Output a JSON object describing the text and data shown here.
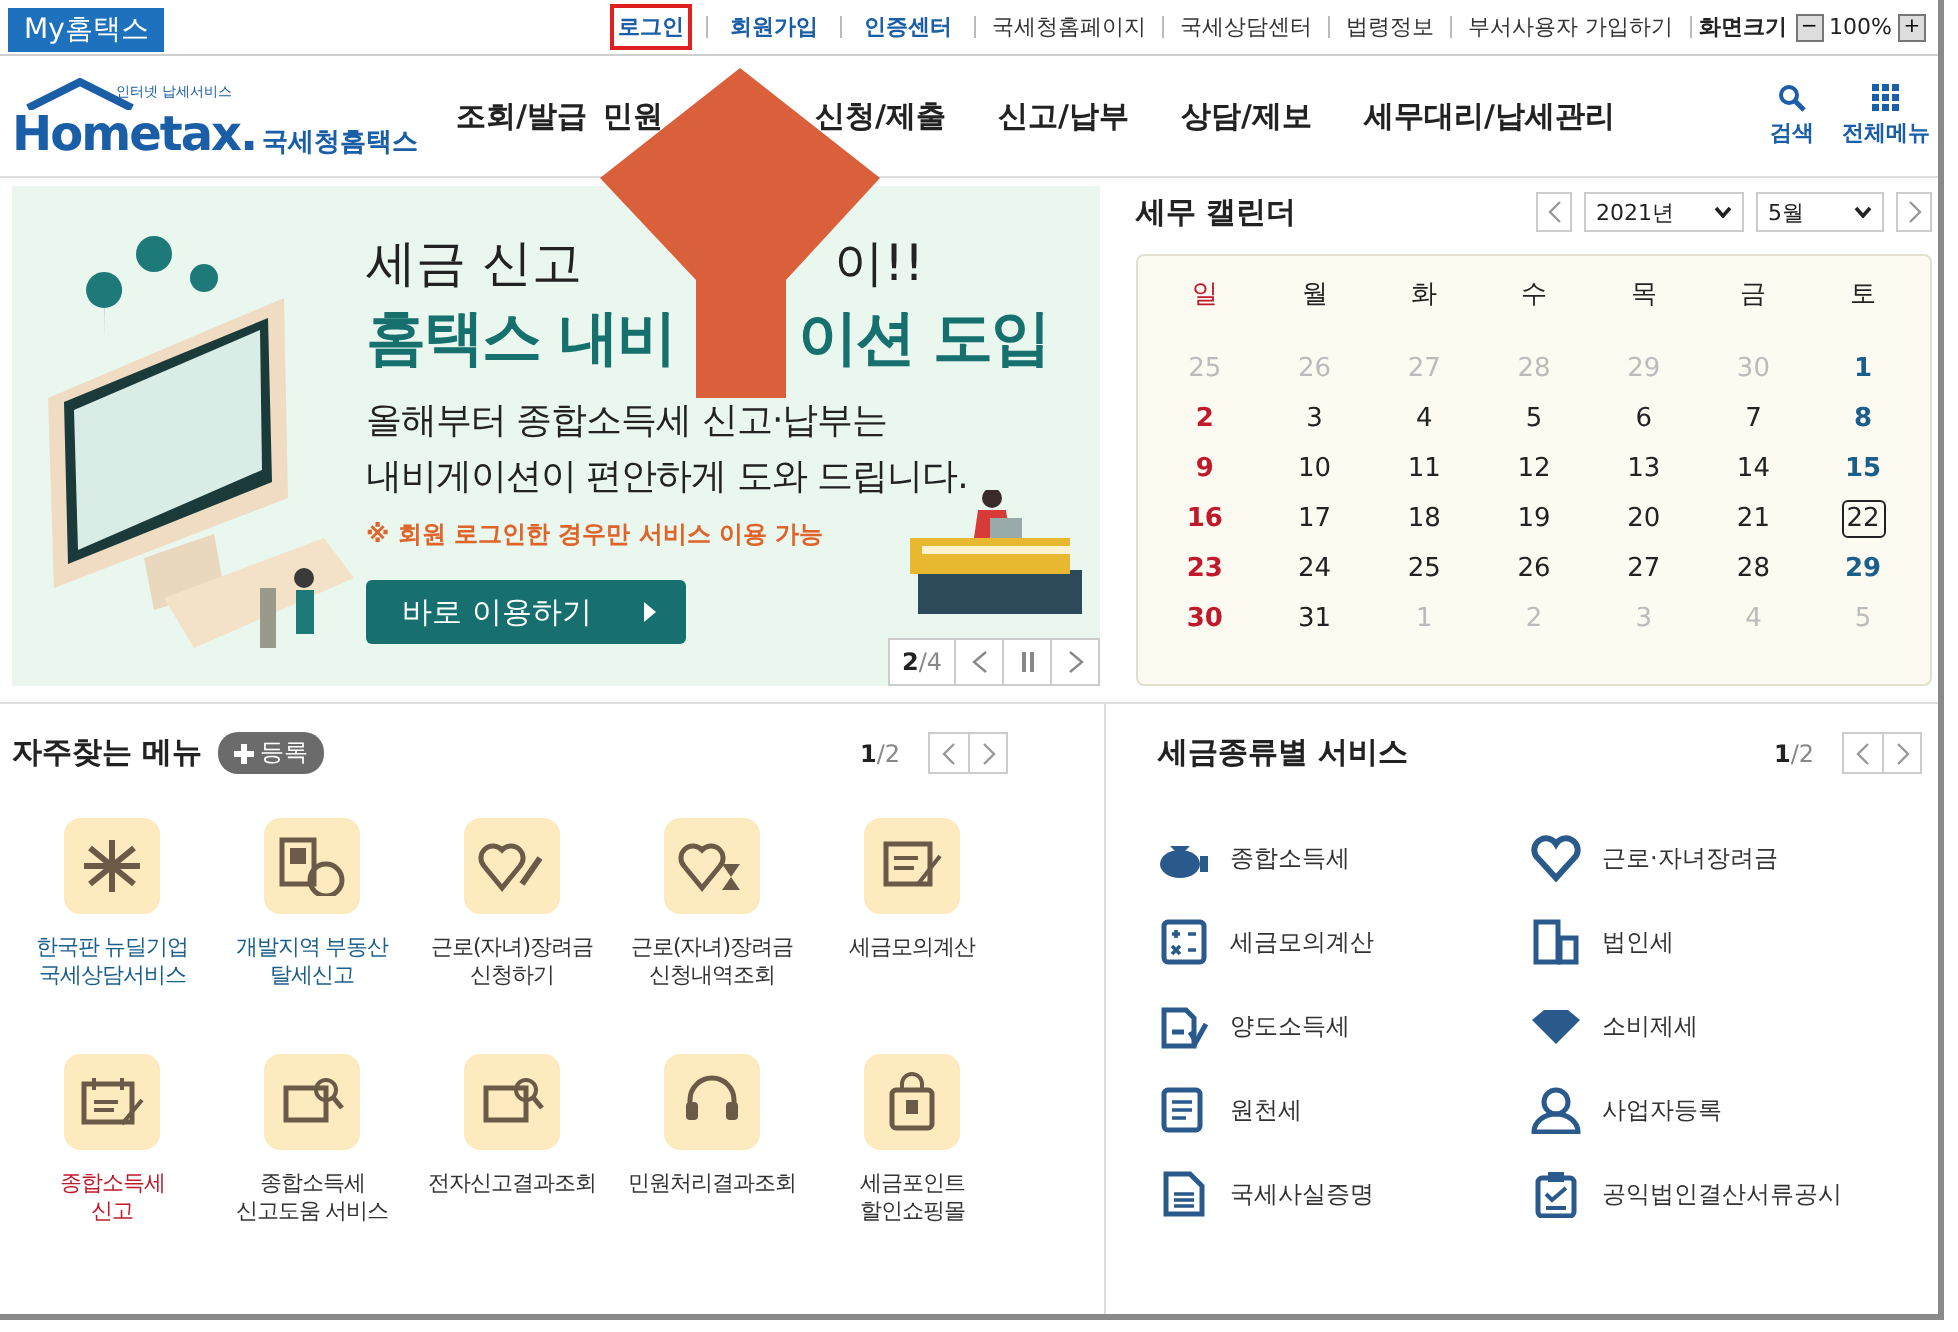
{
  "top_bar": {
    "brand_tab": "My홈택스",
    "links": [
      {
        "label": "로그인",
        "kind": "strong",
        "highlighted": true
      },
      {
        "label": "회원가입",
        "kind": "strong",
        "highlighted": false
      },
      {
        "label": "인증센터",
        "kind": "strong",
        "highlighted": false
      },
      {
        "label": "국세청홈페이지",
        "kind": "plain",
        "highlighted": false
      },
      {
        "label": "국세상담센터",
        "kind": "plain",
        "highlighted": false
      },
      {
        "label": "법령정보",
        "kind": "plain",
        "highlighted": false
      },
      {
        "label": "부서사용자 가입하기",
        "kind": "plain",
        "highlighted": false
      }
    ],
    "zoom": {
      "label": "화면크기",
      "minus": "−",
      "value": "100%",
      "plus": "+"
    }
  },
  "header": {
    "logo_tagline": "인터넷 납세서비스",
    "logo": "Hometax.",
    "logo_name": "국세청홈택스",
    "nav": [
      "조회/발급",
      "민원",
      "신청/제출",
      "신고/납부",
      "상담/제보",
      "세무대리/납세관리"
    ],
    "search": "검색",
    "all_menu": "전체메뉴"
  },
  "banner": {
    "headline_parts": [
      "세금 신고",
      "이!!"
    ],
    "title_parts": [
      "홈택스 내비",
      "이션 도입"
    ],
    "body_lines": [
      "올해부터 종합소득세 신고·납부는",
      "내비게이션이 편안하게 도와 드립니다."
    ],
    "notice": "※ 회원 로그인한 경우만 서비스 이용 가능",
    "button": "바로 이용하기",
    "page_current": "2",
    "page_total": "/4"
  },
  "calendar": {
    "title": "세무 캘린더",
    "year": "2021년",
    "month": "5월",
    "weekdays": [
      {
        "label": "일",
        "kind": "sun"
      },
      {
        "label": "월",
        "kind": "normal"
      },
      {
        "label": "화",
        "kind": "normal"
      },
      {
        "label": "수",
        "kind": "normal"
      },
      {
        "label": "목",
        "kind": "normal"
      },
      {
        "label": "금",
        "kind": "normal"
      },
      {
        "label": "토",
        "kind": "normal"
      }
    ],
    "weeks": [
      [
        {
          "day": "25",
          "kind": "other",
          "selected": false
        },
        {
          "day": "26",
          "kind": "other",
          "selected": false
        },
        {
          "day": "27",
          "kind": "other",
          "selected": false
        },
        {
          "day": "28",
          "kind": "other",
          "selected": false
        },
        {
          "day": "29",
          "kind": "other",
          "selected": false
        },
        {
          "day": "30",
          "kind": "other",
          "selected": false
        },
        {
          "day": "1",
          "kind": "sat",
          "selected": false
        }
      ],
      [
        {
          "day": "2",
          "kind": "sun",
          "selected": false
        },
        {
          "day": "3",
          "kind": "normal",
          "selected": false
        },
        {
          "day": "4",
          "kind": "normal",
          "selected": false
        },
        {
          "day": "5",
          "kind": "normal",
          "selected": false
        },
        {
          "day": "6",
          "kind": "normal",
          "selected": false
        },
        {
          "day": "7",
          "kind": "normal",
          "selected": false
        },
        {
          "day": "8",
          "kind": "sat",
          "selected": false
        }
      ],
      [
        {
          "day": "9",
          "kind": "sun",
          "selected": false
        },
        {
          "day": "10",
          "kind": "normal",
          "selected": false
        },
        {
          "day": "11",
          "kind": "normal",
          "selected": false
        },
        {
          "day": "12",
          "kind": "normal",
          "selected": false
        },
        {
          "day": "13",
          "kind": "normal",
          "selected": false
        },
        {
          "day": "14",
          "kind": "normal",
          "selected": false
        },
        {
          "day": "15",
          "kind": "sat",
          "selected": false
        }
      ],
      [
        {
          "day": "16",
          "kind": "sun",
          "selected": false
        },
        {
          "day": "17",
          "kind": "normal",
          "selected": false
        },
        {
          "day": "18",
          "kind": "normal",
          "selected": false
        },
        {
          "day": "19",
          "kind": "normal",
          "selected": false
        },
        {
          "day": "20",
          "kind": "normal",
          "selected": false
        },
        {
          "day": "21",
          "kind": "normal",
          "selected": false
        },
        {
          "day": "22",
          "kind": "normal",
          "selected": true
        }
      ],
      [
        {
          "day": "23",
          "kind": "sun",
          "selected": false
        },
        {
          "day": "24",
          "kind": "normal",
          "selected": false
        },
        {
          "day": "25",
          "kind": "normal",
          "selected": false
        },
        {
          "day": "26",
          "kind": "normal",
          "selected": false
        },
        {
          "day": "27",
          "kind": "normal",
          "selected": false
        },
        {
          "day": "28",
          "kind": "normal",
          "selected": false
        },
        {
          "day": "29",
          "kind": "sat",
          "selected": false
        }
      ],
      [
        {
          "day": "30",
          "kind": "sun",
          "selected": false
        },
        {
          "day": "31",
          "kind": "normal",
          "selected": false
        },
        {
          "day": "1",
          "kind": "other",
          "selected": false
        },
        {
          "day": "2",
          "kind": "other",
          "selected": false
        },
        {
          "day": "3",
          "kind": "other",
          "selected": false
        },
        {
          "day": "4",
          "kind": "other",
          "selected": false
        },
        {
          "day": "5",
          "kind": "other",
          "selected": false
        }
      ]
    ]
  },
  "frequent_menu": {
    "title": "자주찾는 메뉴",
    "add_button": "등록",
    "page_current": "1",
    "page_total": "/2",
    "items": [
      {
        "lines": [
          "한국판 뉴딜기업",
          "국세상담서비스"
        ],
        "kind": "link"
      },
      {
        "lines": [
          "개발지역 부동산",
          "탈세신고"
        ],
        "kind": "link"
      },
      {
        "lines": [
          "근로(자녀)장려금",
          "신청하기"
        ],
        "kind": "plain"
      },
      {
        "lines": [
          "근로(자녀)장려금",
          "신청내역조회"
        ],
        "kind": "plain"
      },
      {
        "lines": [
          "세금모의계산"
        ],
        "kind": "plain"
      },
      {
        "lines": [
          "종합소득세",
          "신고"
        ],
        "kind": "alert"
      },
      {
        "lines": [
          "종합소득세",
          "신고도움 서비스"
        ],
        "kind": "plain"
      },
      {
        "lines": [
          "전자신고결과조회"
        ],
        "kind": "plain"
      },
      {
        "lines": [
          "민원처리결과조회"
        ],
        "kind": "plain"
      },
      {
        "lines": [
          "세금포인트",
          "할인쇼핑몰"
        ],
        "kind": "plain"
      }
    ]
  },
  "tax_services": {
    "title": "세금종류별 서비스",
    "page_current": "1",
    "page_total": "/2",
    "items": [
      "종합소득세",
      "근로·자녀장려금",
      "세금모의계산",
      "법인세",
      "양도소득세",
      "소비제세",
      "원천세",
      "사업자등록",
      "국세사실증명",
      "공익법인결산서류공시"
    ]
  }
}
